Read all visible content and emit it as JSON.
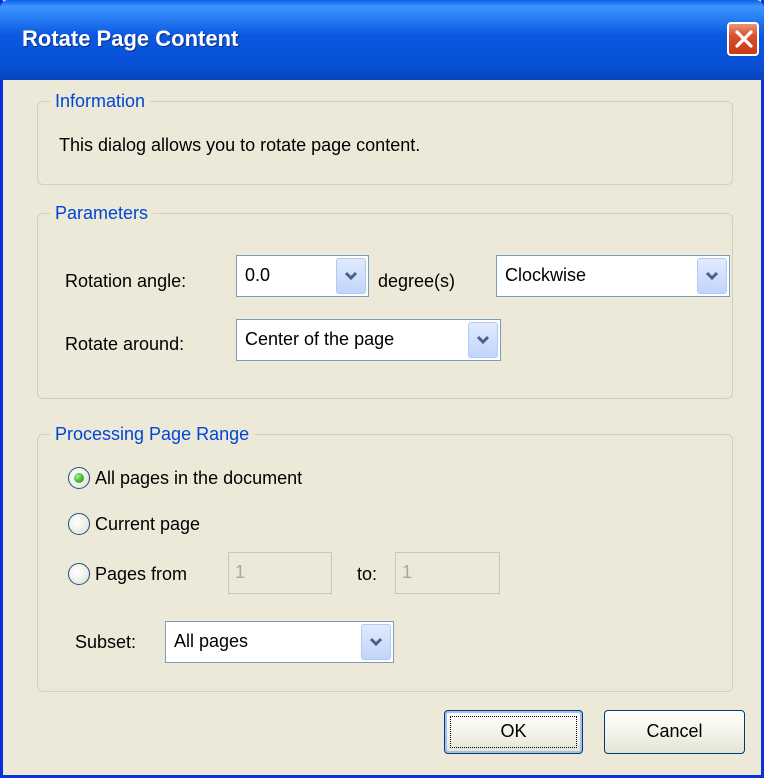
{
  "window": {
    "title": "Rotate Page Content"
  },
  "information": {
    "legend": "Information",
    "text": "This dialog allows you to rotate page content."
  },
  "parameters": {
    "legend": "Parameters",
    "rotation_label": "Rotation angle:",
    "rotation_value": "0.0",
    "degrees_label": "degree(s)",
    "direction_value": "Clockwise",
    "rotate_around_label": "Rotate around:",
    "rotate_around_value": "Center of the page"
  },
  "page_range": {
    "legend": "Processing Page Range",
    "options": [
      {
        "label": "All pages in the document",
        "selected": true
      },
      {
        "label": "Current page",
        "selected": false
      },
      {
        "label": "Pages from",
        "selected": false
      }
    ],
    "from_value": "1",
    "to_label": "to:",
    "to_value": "1",
    "subset_label": "Subset:",
    "subset_value": "All pages"
  },
  "buttons": {
    "ok": "OK",
    "cancel": "Cancel"
  },
  "colors": {
    "title_bar": "#0A57E0",
    "legend_text": "#0046D5",
    "dialog_bg": "#ECE9D8",
    "close_button": "#D9512C",
    "radio_selected": "#4CB73F"
  }
}
